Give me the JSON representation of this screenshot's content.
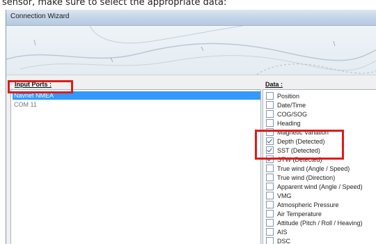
{
  "caption": "sensor, make sure to select the appropriate data:",
  "window": {
    "title": "Connection Wizard"
  },
  "input_ports": {
    "label": "Input Ports :",
    "items": [
      {
        "label": "Navnet NMEA",
        "selected": true
      },
      {
        "label": "COM 11",
        "selected": false
      }
    ]
  },
  "data": {
    "label": "Data :",
    "items": [
      {
        "label": "Position",
        "checked": false
      },
      {
        "label": "Date/Time",
        "checked": false
      },
      {
        "label": "COG/SOG",
        "checked": false
      },
      {
        "label": "Heading",
        "checked": false
      },
      {
        "label": "Magnetic Variation",
        "checked": false
      },
      {
        "label": "Depth (Detected)",
        "checked": true
      },
      {
        "label": "SST (Detected)",
        "checked": true
      },
      {
        "label": "STW (Detected)",
        "checked": true
      },
      {
        "label": "True wind (Angle / Speed)",
        "checked": false
      },
      {
        "label": "True wind (Direction)",
        "checked": false
      },
      {
        "label": "Apparent wind (Angle / Speed)",
        "checked": false
      },
      {
        "label": "VMG",
        "checked": false
      },
      {
        "label": "Atmospheric Pressure",
        "checked": false
      },
      {
        "label": "Air Temperature",
        "checked": false
      },
      {
        "label": "Attitude (Pitch / Roll / Heaving)",
        "checked": false
      },
      {
        "label": "AIS",
        "checked": false
      },
      {
        "label": "DSC",
        "checked": false
      }
    ]
  },
  "colors": {
    "selection": "#3399ff",
    "highlight": "#e01a1a"
  }
}
